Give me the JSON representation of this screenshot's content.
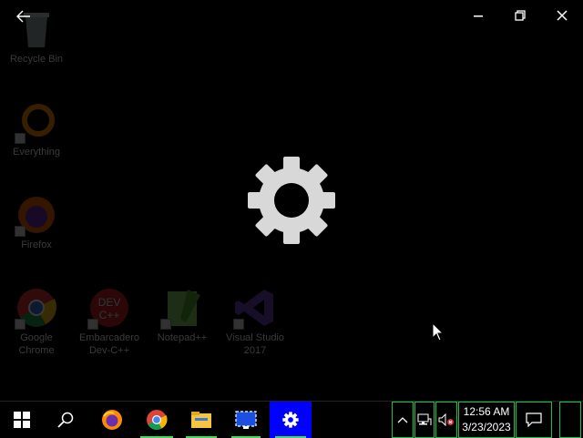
{
  "desktop_icons": [
    {
      "label": "Recycle Bin",
      "icon": "recycle-bin-icon"
    },
    {
      "label": "Everything",
      "icon": "everything-icon"
    },
    {
      "label": "Firefox",
      "icon": "firefox-icon"
    },
    {
      "label_line1": "Google",
      "label_line2": "Chrome",
      "icon": "chrome-icon"
    },
    {
      "label_line1": "Embarcadero",
      "label_line2": "Dev-C++",
      "icon": "devcpp-icon"
    },
    {
      "label": "Notepad++",
      "icon": "notepadpp-icon"
    },
    {
      "label_line1": "Visual Studio",
      "label_line2": "2017",
      "icon": "visual-studio-icon"
    }
  ],
  "window": {
    "back_icon": "back-arrow-icon",
    "minimize_icon": "minimize-icon",
    "restore_icon": "restore-icon",
    "close_icon": "close-icon",
    "splash_icon": "gear-icon"
  },
  "taskbar": {
    "apps": [
      "start-icon",
      "search-icon",
      "firefox-icon",
      "chrome-icon",
      "file-explorer-icon",
      "remote-desktop-icon",
      "settings-icon"
    ],
    "clock_time": "12:56 AM",
    "clock_date": "3/23/2023",
    "accent": "#3ddc55",
    "active_color": "#0000ff"
  }
}
